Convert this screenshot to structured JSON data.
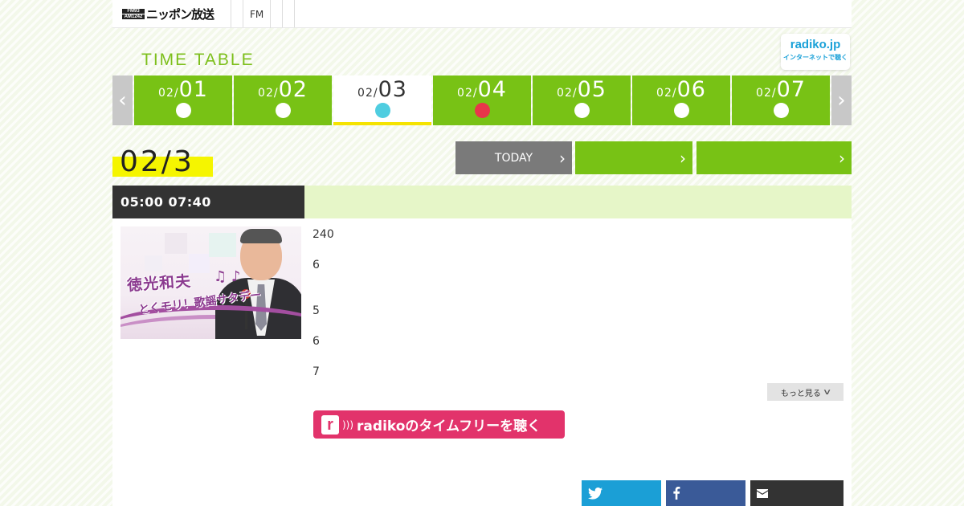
{
  "header": {
    "logo_badge_top": "FM93",
    "logo_badge_bottom": "AM1242",
    "logo_text": "ニッポン放送",
    "nav_items": [
      "FM"
    ]
  },
  "timetable": {
    "title": "TIME TABLE",
    "radiko_badge": {
      "name": "radiko.jp",
      "sub": "インターネットで聴く"
    },
    "days": [
      {
        "month": "02/",
        "day": "01",
        "dot_color": "#ffffff",
        "active": false
      },
      {
        "month": "02/",
        "day": "02",
        "dot_color": "#ffffff",
        "active": false
      },
      {
        "month": "02/",
        "day": "03",
        "dot_color": "#4fcde0",
        "active": true
      },
      {
        "month": "02/",
        "day": "04",
        "dot_color": "#e8364a",
        "active": false
      },
      {
        "month": "02/",
        "day": "05",
        "dot_color": "#ffffff",
        "active": false
      },
      {
        "month": "02/",
        "day": "06",
        "dot_color": "#ffffff",
        "active": false
      },
      {
        "month": "02/",
        "day": "07",
        "dot_color": "#ffffff",
        "active": false
      }
    ],
    "selected_date": "02/3",
    "today_button": "TODAY"
  },
  "program": {
    "time": "05:00  07:40",
    "image": {
      "title_line1": "徳光和夫",
      "title_line2": "とくモリ！歌謡サタデー",
      "notes": "♫ ♪"
    },
    "lines": [
      "240",
      "6",
      "5",
      "6",
      "7"
    ],
    "more_button": "もっと見る",
    "radiko_button": "radikoのタイムフリーを聴く"
  },
  "share": [
    "twitter-icon",
    "facebook-icon",
    "mail-icon"
  ],
  "colors": {
    "green": "#78c215",
    "title_green": "#7dbf1c",
    "highlight_yellow": "#f5f500",
    "radiko_pink": "#e2336b",
    "twitter": "#1b9fd6",
    "facebook": "#3a5a98",
    "dark": "#333333"
  }
}
